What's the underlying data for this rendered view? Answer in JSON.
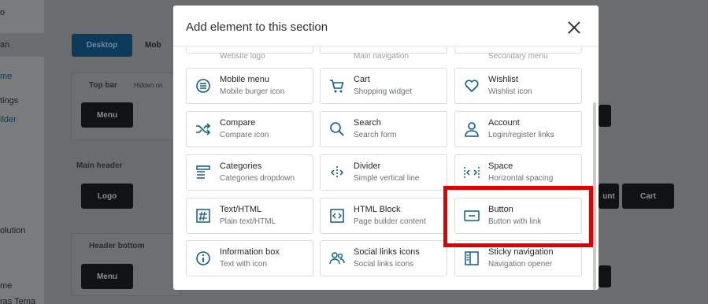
{
  "background": {
    "sidebar_items": [
      "o",
      "an",
      "me",
      "tings",
      "ilder",
      "olution",
      "me",
      "ras Tema"
    ],
    "desktop_label": "Desktop",
    "mobile_label": "Mob",
    "top_bar": "Top bar",
    "hidden_on": "Hidden on",
    "menu_label": "Menu",
    "main_header": "Main header",
    "logo_label": "Logo",
    "header_bottom": "Header bottom",
    "cart_label": "Cart",
    "account_fragment": "unt"
  },
  "modal": {
    "title": "Add element to this section",
    "partial_row": [
      "Website logo",
      "Main navigation",
      "Secondary menu"
    ],
    "cards": [
      {
        "title": "Mobile menu",
        "subtitle": "Mobile burger icon",
        "icon": "mobile-menu-icon"
      },
      {
        "title": "Cart",
        "subtitle": "Shopping widget",
        "icon": "cart-icon"
      },
      {
        "title": "Wishlist",
        "subtitle": "Wishlist icon",
        "icon": "heart-icon"
      },
      {
        "title": "Compare",
        "subtitle": "Compare icon",
        "icon": "shuffle-icon"
      },
      {
        "title": "Search",
        "subtitle": "Search form",
        "icon": "search-icon"
      },
      {
        "title": "Account",
        "subtitle": "Login/register links",
        "icon": "user-icon"
      },
      {
        "title": "Categories",
        "subtitle": "Categories dropdown",
        "icon": "categories-icon"
      },
      {
        "title": "Divider",
        "subtitle": "Simple vertical line",
        "icon": "divider-icon"
      },
      {
        "title": "Space",
        "subtitle": "Horizontal spacing",
        "icon": "space-icon"
      },
      {
        "title": "Text/HTML",
        "subtitle": "Plain text/HTML",
        "icon": "text-html-icon"
      },
      {
        "title": "HTML Block",
        "subtitle": "Page builder content",
        "icon": "code-block-icon"
      },
      {
        "title": "Button",
        "subtitle": "Button with link",
        "icon": "button-icon"
      },
      {
        "title": "Information box",
        "subtitle": "Text with icon",
        "icon": "info-icon"
      },
      {
        "title": "Social links icons",
        "subtitle": "Social links icons",
        "icon": "social-icon"
      },
      {
        "title": "Sticky navigation",
        "subtitle": "Navigation opener",
        "icon": "sticky-nav-icon"
      }
    ]
  },
  "colors": {
    "accent": "#0b5d94",
    "highlight": "#e00000"
  }
}
